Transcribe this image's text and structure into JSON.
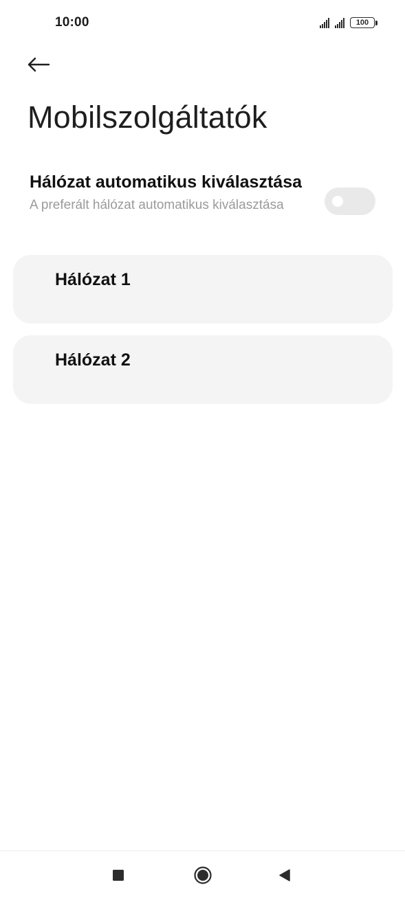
{
  "status_bar": {
    "time": "10:00",
    "battery": "100"
  },
  "header": {
    "back_icon": "arrow-left-icon",
    "title": "Mobilszolgáltatók"
  },
  "auto_select": {
    "title": "Hálózat automatikus kiválasztása",
    "description": "A preferált hálózat automatikus kiválasztása",
    "toggle_on": false,
    "toggle_color_off": "#e9e9e9"
  },
  "networks": [
    {
      "label": "Hálózat 1"
    },
    {
      "label": "Hálózat 2"
    }
  ],
  "nav_bar": {
    "recents_icon": "square-icon",
    "home_icon": "circle-icon",
    "back_icon": "triangle-back-icon"
  },
  "colors": {
    "card_background": "#f4f4f4",
    "secondary_text": "#9a9a9a"
  }
}
